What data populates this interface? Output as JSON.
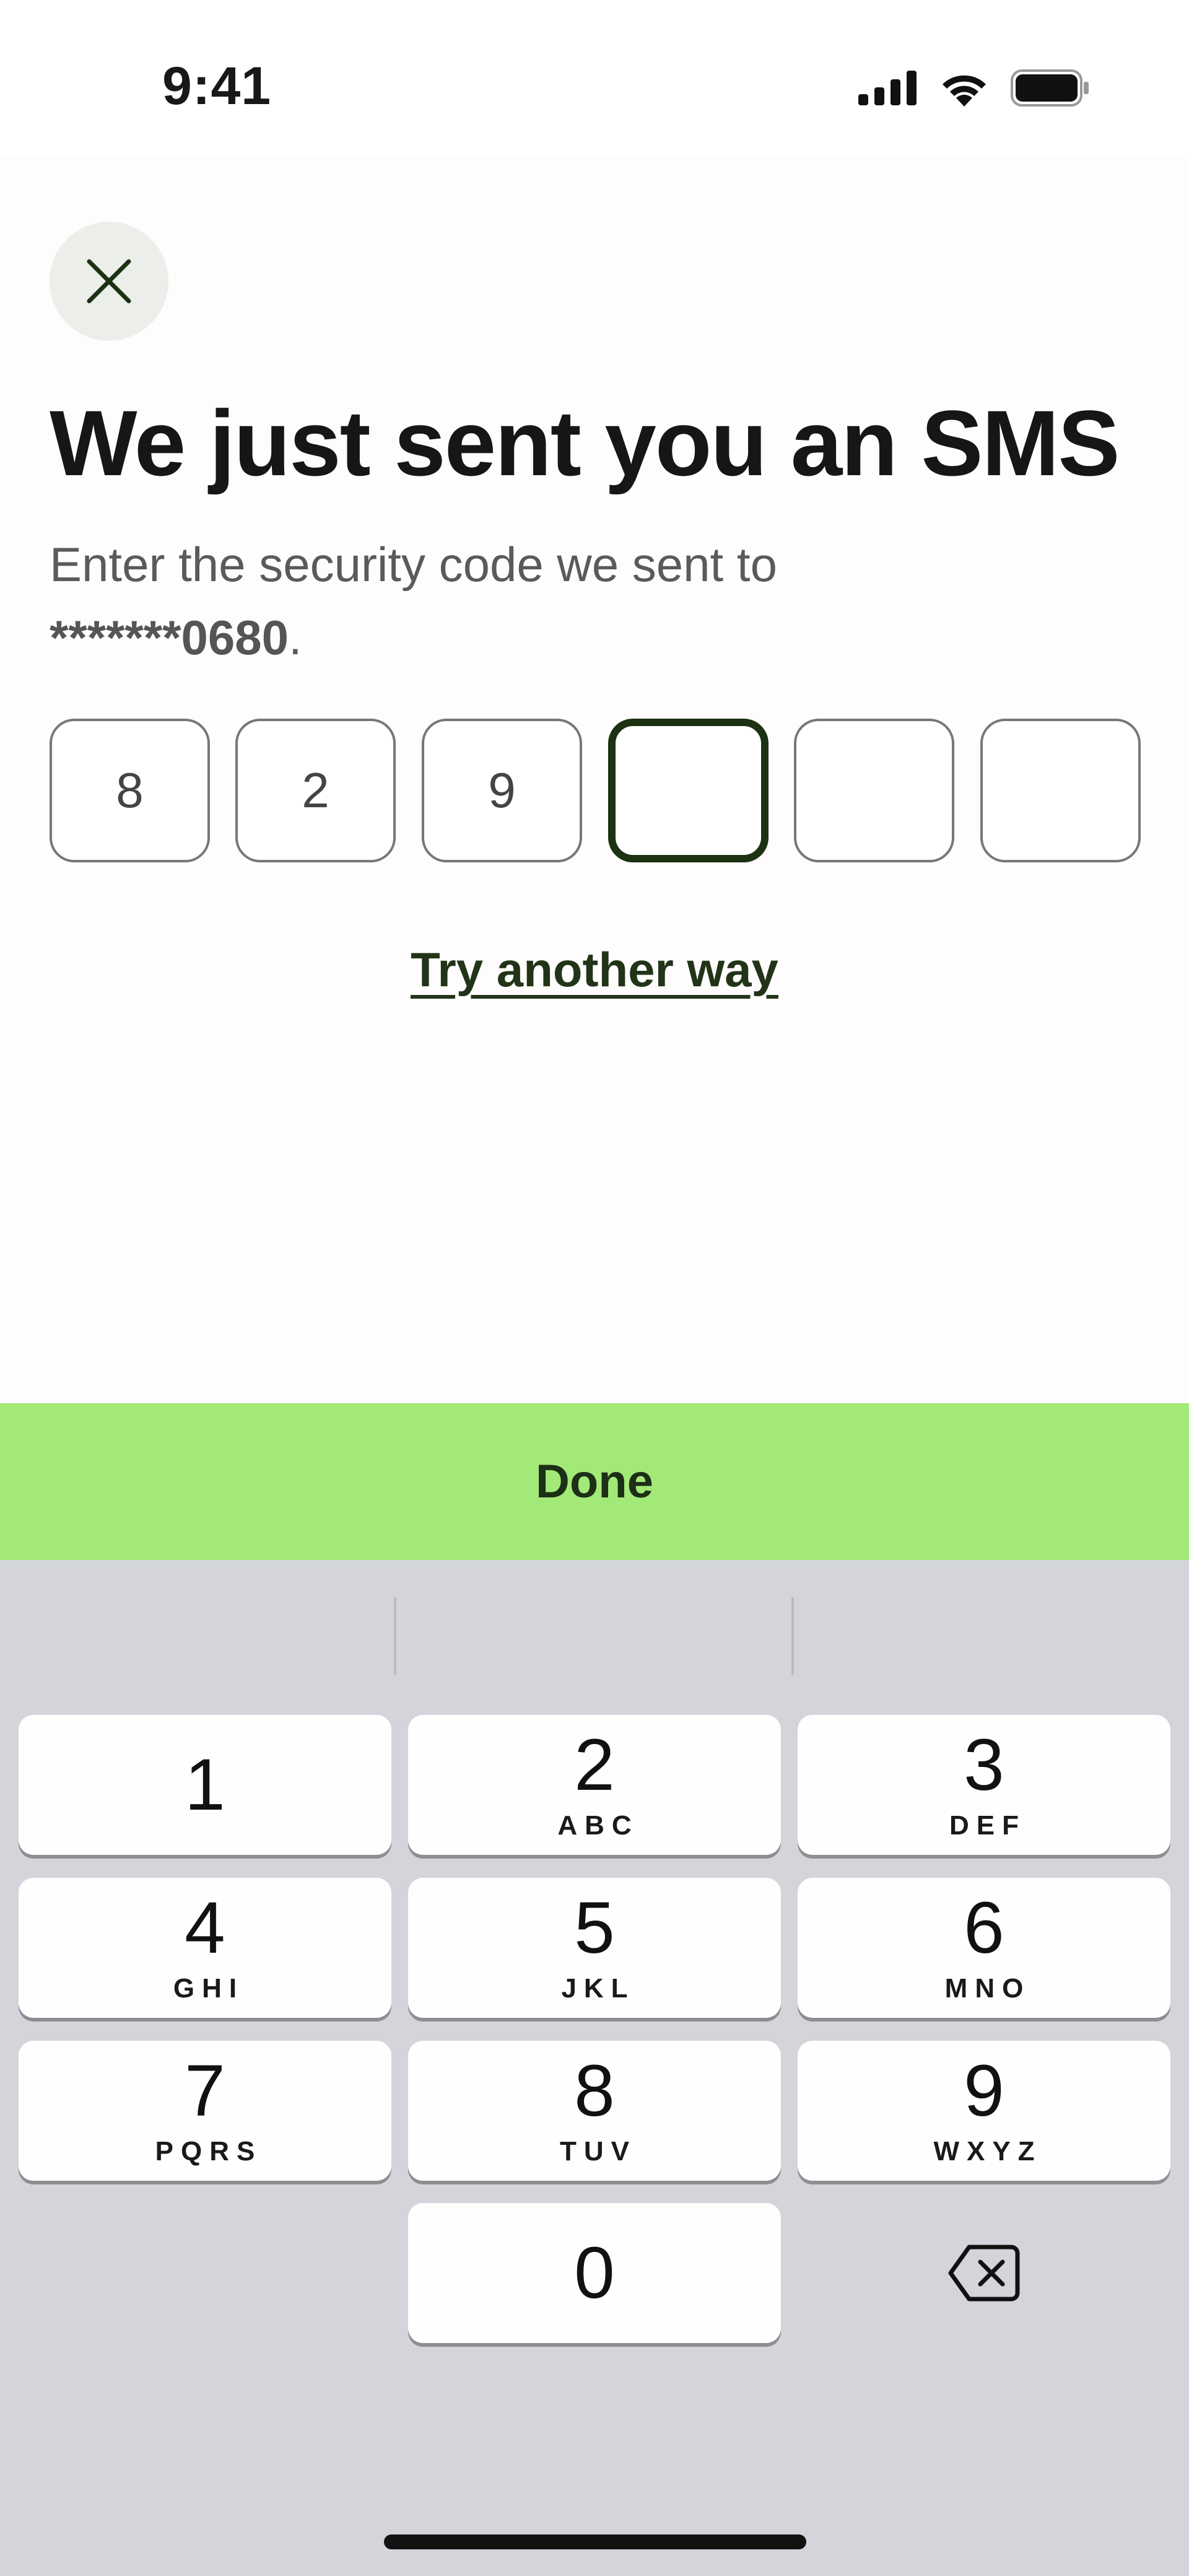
{
  "status_bar": {
    "time": "9:41",
    "icons": [
      "cellular-signal-icon",
      "wifi-icon",
      "battery-icon"
    ]
  },
  "header": {
    "close_icon": "close-icon",
    "title": "We just sent you an SMS",
    "subtitle_prefix": "Enter the security code we sent to",
    "masked_phone": "*******0680",
    "subtitle_suffix": "."
  },
  "code_input": {
    "digits": [
      "8",
      "2",
      "9",
      "",
      "",
      ""
    ],
    "active_index": 3
  },
  "links": {
    "try_another_way": "Try another way"
  },
  "done_button": {
    "label": "Done",
    "color": "#a3e978"
  },
  "keypad": {
    "keys": [
      {
        "num": "1",
        "letters": ""
      },
      {
        "num": "2",
        "letters": "ABC"
      },
      {
        "num": "3",
        "letters": "DEF"
      },
      {
        "num": "4",
        "letters": "GHI"
      },
      {
        "num": "5",
        "letters": "JKL"
      },
      {
        "num": "6",
        "letters": "MNO"
      },
      {
        "num": "7",
        "letters": "PQRS"
      },
      {
        "num": "8",
        "letters": "TUV"
      },
      {
        "num": "9",
        "letters": "WXYZ"
      },
      {
        "num": "0",
        "letters": ""
      }
    ],
    "delete_icon": "backspace-icon"
  },
  "colors": {
    "accent_dark": "#1c3213",
    "keypad_bg": "#d4d5da"
  }
}
